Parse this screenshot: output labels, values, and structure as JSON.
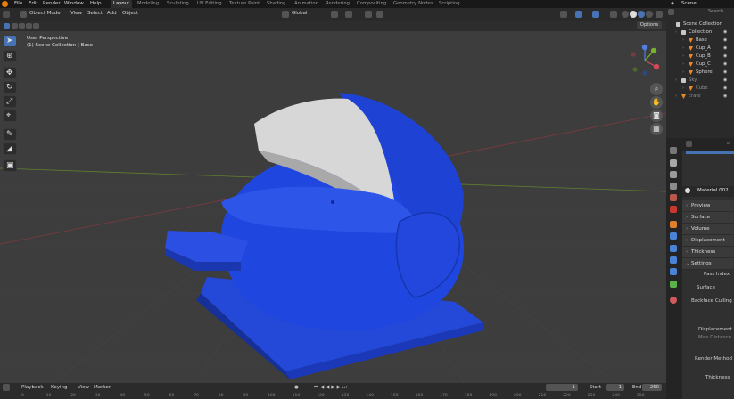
{
  "menu": {
    "file": "File",
    "edit": "Edit",
    "render": "Render",
    "window": "Window",
    "help": "Help"
  },
  "workspaces": [
    "Layout",
    "Modeling",
    "Sculpting",
    "UV Editing",
    "Texture Paint",
    "Shading",
    "Animation",
    "Rendering",
    "Compositing",
    "Geometry Nodes",
    "Scripting"
  ],
  "scene": "Scene",
  "viewport": {
    "mode": "Object Mode",
    "view": "View",
    "select": "Select",
    "add": "Add",
    "object": "Object",
    "orientation": "Global",
    "options": "Options",
    "perspective": "User Perspective",
    "collection_info": "(1) Scene Collection | Base"
  },
  "outliner": {
    "search": "Search",
    "rows": [
      {
        "label": "Scene Collection",
        "kind": "collection"
      },
      {
        "label": "Collection",
        "kind": "collection"
      },
      {
        "label": "Base",
        "kind": "object"
      },
      {
        "label": "Cup_A",
        "kind": "object"
      },
      {
        "label": "Cup_B",
        "kind": "object"
      },
      {
        "label": "Cup_C",
        "kind": "object"
      },
      {
        "label": "Sphere",
        "kind": "object"
      },
      {
        "label": "Sky",
        "kind": "collection"
      },
      {
        "label": "Cube",
        "kind": "object"
      },
      {
        "label": "crate",
        "kind": "object"
      }
    ]
  },
  "properties": {
    "material": "Material.002",
    "sections": [
      "Preview",
      "Surface",
      "Volume",
      "Displacement",
      "Thickness",
      "Settings"
    ],
    "pass_index": "Pass Index",
    "surface": "Surface",
    "backface": "Backface Culling",
    "displacement": "Displacement",
    "max_distance": "Max Distance",
    "render_method": "Render Method",
    "thickness": "Thickness"
  },
  "timeline": {
    "playback": "Playback",
    "keying": "Keying",
    "view": "View",
    "marker": "Marker",
    "current_frame": "1",
    "start_label": "Start",
    "start": "1",
    "end_label": "End",
    "end": "250",
    "ticks": [
      "0",
      "10",
      "20",
      "30",
      "40",
      "50",
      "60",
      "70",
      "80",
      "90",
      "100",
      "110",
      "120",
      "130",
      "140",
      "150",
      "160",
      "170",
      "180",
      "190",
      "200",
      "210",
      "220",
      "230",
      "240",
      "250"
    ]
  },
  "colors": {
    "model": "#1f47e0",
    "shell": "#d8d8d8",
    "accent": "#4772b3",
    "brand": "#e87d0d"
  }
}
